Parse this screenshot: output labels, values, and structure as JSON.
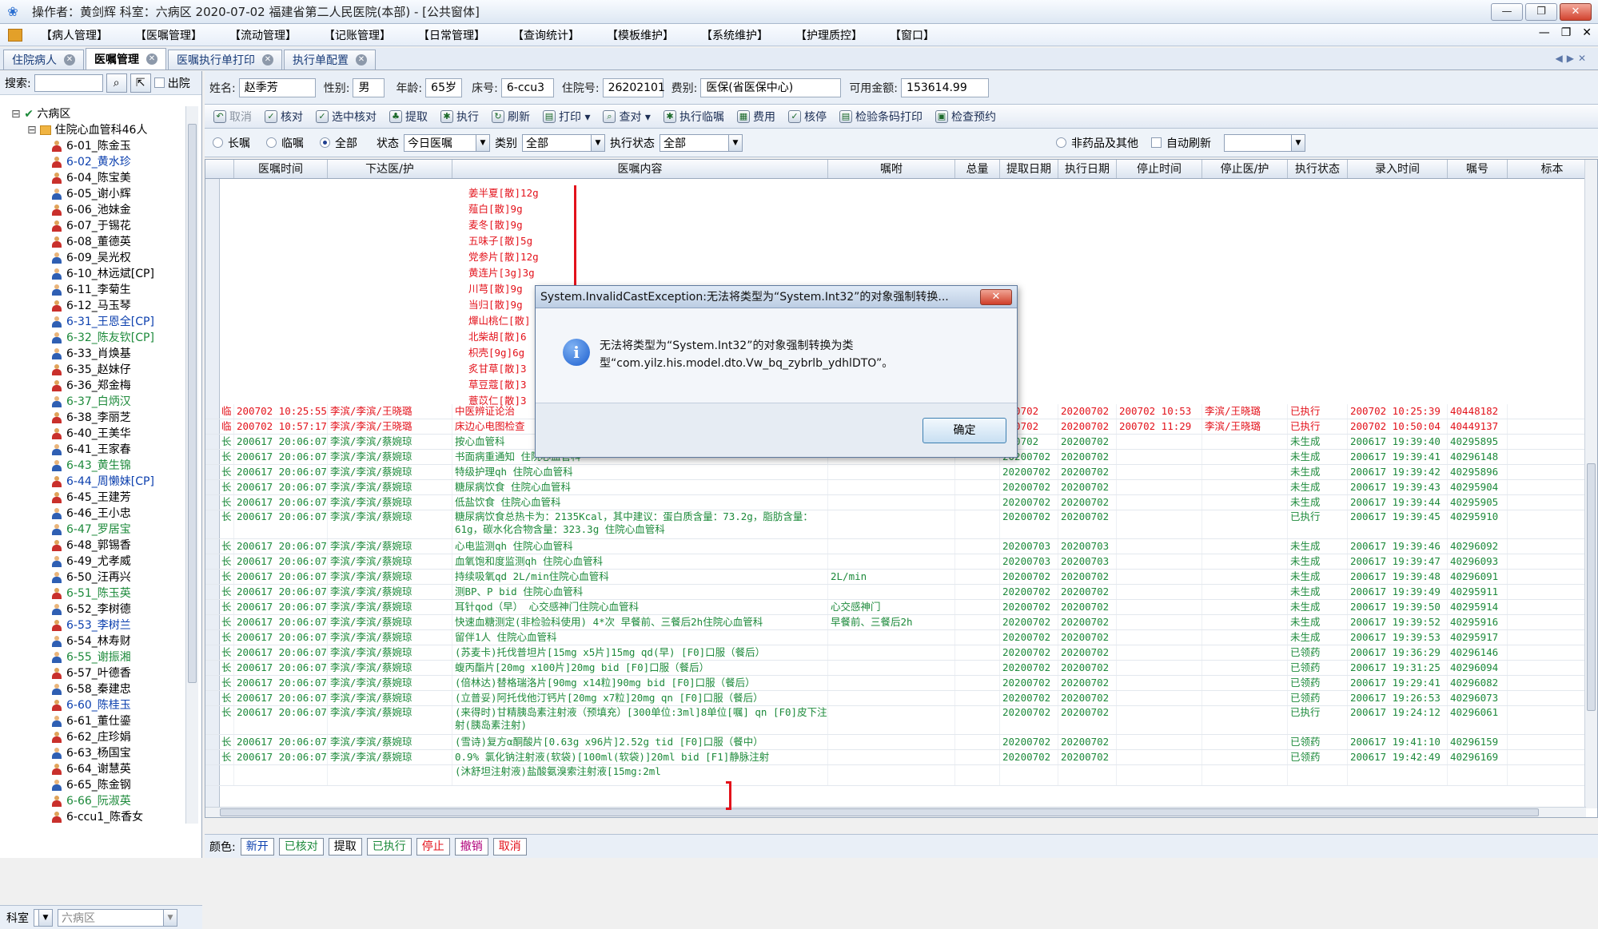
{
  "window": {
    "title": "操作者：黄剑辉  科室：六病区  2020-07-02  福建省第二人民医院(本部) - [公共窗体]",
    "buttons": [
      "—",
      "❐",
      "✕"
    ]
  },
  "menu": [
    "【病人管理】",
    "【医嘱管理】",
    "【流动管理】",
    "【记账管理】",
    "【日常管理】",
    "【查询统计】",
    "【模板维护】",
    "【系统维护】",
    "【护理质控】",
    "【窗口】"
  ],
  "mdi_buttons": [
    "—",
    "❐",
    "✕"
  ],
  "tabs": [
    {
      "label": "住院病人"
    },
    {
      "label": "医嘱管理"
    },
    {
      "label": "医嘱执行单打印"
    },
    {
      "label": "执行单配置"
    }
  ],
  "left": {
    "search_label": "搜索:",
    "discharge_label": "出院",
    "root": "六病区",
    "dept": "住院心血管科46人",
    "patients": [
      {
        "t": "6-01_陈金玉",
        "c": "#000",
        "m": false
      },
      {
        "t": "6-02_黄水珍",
        "c": "#0b3fae",
        "m": false
      },
      {
        "t": "6-04_陈宝美",
        "c": "#000",
        "m": false
      },
      {
        "t": "6-05_谢小辉",
        "c": "#000",
        "m": true
      },
      {
        "t": "6-06_池妹金",
        "c": "#000",
        "m": false
      },
      {
        "t": "6-07_于锡花",
        "c": "#000",
        "m": false
      },
      {
        "t": "6-08_董德英",
        "c": "#000",
        "m": false
      },
      {
        "t": "6-09_吴光权",
        "c": "#000",
        "m": true
      },
      {
        "t": "6-10_林远斌[CP]",
        "c": "#000",
        "m": true
      },
      {
        "t": "6-11_李菊生",
        "c": "#000",
        "m": true
      },
      {
        "t": "6-12_马玉琴",
        "c": "#000",
        "m": false
      },
      {
        "t": "6-31_王恩全[CP]",
        "c": "#0b3fae",
        "m": true
      },
      {
        "t": "6-32_陈友钦[CP]",
        "c": "#1d8a3b",
        "m": true
      },
      {
        "t": "6-33_肖焕基",
        "c": "#000",
        "m": true
      },
      {
        "t": "6-35_赵妹仔",
        "c": "#000",
        "m": false
      },
      {
        "t": "6-36_郑金梅",
        "c": "#000",
        "m": false
      },
      {
        "t": "6-37_白炳汉",
        "c": "#1d8a3b",
        "m": true
      },
      {
        "t": "6-38_李丽芝",
        "c": "#000",
        "m": false
      },
      {
        "t": "6-40_王美华",
        "c": "#000",
        "m": false
      },
      {
        "t": "6-41_王家春",
        "c": "#000",
        "m": true
      },
      {
        "t": "6-43_黄生锦",
        "c": "#1d8a3b",
        "m": true
      },
      {
        "t": "6-44_周懒妹[CP]",
        "c": "#0b3fae",
        "m": false
      },
      {
        "t": "6-45_王建芳",
        "c": "#000",
        "m": false
      },
      {
        "t": "6-46_王小忠",
        "c": "#000",
        "m": true
      },
      {
        "t": "6-47_罗居宝",
        "c": "#1d8a3b",
        "m": true
      },
      {
        "t": "6-48_郭锡香",
        "c": "#000",
        "m": false
      },
      {
        "t": "6-49_尤孝威",
        "c": "#000",
        "m": true
      },
      {
        "t": "6-50_汪再兴",
        "c": "#000",
        "m": true
      },
      {
        "t": "6-51_陈玉英",
        "c": "#1d8a3b",
        "m": false
      },
      {
        "t": "6-52_李树德",
        "c": "#000",
        "m": true
      },
      {
        "t": "6-53_李树兰",
        "c": "#0b3fae",
        "m": false
      },
      {
        "t": "6-54_林寿财",
        "c": "#000",
        "m": true
      },
      {
        "t": "6-55_谢振湘",
        "c": "#1d8a3b",
        "m": true
      },
      {
        "t": "6-57_叶德香",
        "c": "#000",
        "m": false
      },
      {
        "t": "6-58_秦建忠",
        "c": "#000",
        "m": true
      },
      {
        "t": "6-60_陈桂玉",
        "c": "#0b3fae",
        "m": false
      },
      {
        "t": "6-61_董仕鎏",
        "c": "#000",
        "m": true
      },
      {
        "t": "6-62_庄珍娟",
        "c": "#000",
        "m": false
      },
      {
        "t": "6-63_杨国宝",
        "c": "#000",
        "m": true
      },
      {
        "t": "6-64_谢慧英",
        "c": "#000",
        "m": false
      },
      {
        "t": "6-65_陈金钢",
        "c": "#000",
        "m": true
      },
      {
        "t": "6-66_阮淑英",
        "c": "#1d8a3b",
        "m": false
      },
      {
        "t": "6-ccu1_陈香女",
        "c": "#000",
        "m": false
      }
    ],
    "bottom_dept_label": "科室",
    "bottom_dept_value": "六病区"
  },
  "patient": {
    "name_label": "姓名:",
    "name": "赵季芳",
    "sex_label": "性别:",
    "sex": "男",
    "age_label": "年龄:",
    "age": "65岁",
    "bed_label": "床号:",
    "bed": "6-ccu3",
    "admission_label": "住院号:",
    "admission_no": "26202101",
    "fee_type_label": "费别:",
    "fee_type": "医保(省医保中心)",
    "balance_label": "可用金额:",
    "balance": "153614.99"
  },
  "toolbar": [
    {
      "l": "取消",
      "i": "↶",
      "d": true
    },
    {
      "l": "核对",
      "i": "✓",
      "d": false
    },
    {
      "l": "选中核对",
      "i": "✓",
      "d": false
    },
    {
      "l": "提取",
      "i": "♣",
      "d": false
    },
    {
      "l": "执行",
      "i": "✱",
      "d": false
    },
    {
      "l": "刷新",
      "i": "↻",
      "d": false
    },
    {
      "l": "打印 ▾",
      "i": "▤",
      "d": false
    },
    {
      "l": "查对 ▾",
      "i": "⌕",
      "d": false
    },
    {
      "l": "执行临嘱",
      "i": "✱",
      "d": false
    },
    {
      "l": "费用",
      "i": "▦",
      "d": false
    },
    {
      "l": "核停",
      "i": "✓",
      "d": false
    },
    {
      "l": "检验条码打印",
      "i": "▤",
      "d": false
    },
    {
      "l": "检查预约",
      "i": "▣",
      "d": false
    }
  ],
  "filters": {
    "long": "长嘱",
    "temp": "临嘱",
    "all": "全部",
    "status_label": "状态",
    "status": "今日医嘱",
    "type_label": "类别",
    "type": "全部",
    "exec_label": "执行状态",
    "exec": "全部",
    "nondrug": "非药品及其他",
    "autorefresh": "自动刷新"
  },
  "columns": [
    "医嘱时间",
    "下达医/护",
    "医嘱内容",
    "嘱咐",
    "总量",
    "提取日期",
    "执行日期",
    "停止时间",
    "停止医/护",
    "执行状态",
    "录入时间",
    "嘱号",
    "标本"
  ],
  "herbs": [
    "姜半夏[散]12g",
    "薤白[散]9g",
    "麦冬[散]9g",
    "五味子[散]5g",
    "党参片[散]12g",
    "黄连片[3g]3g",
    "川芎[散]9g",
    "当归[散]9g",
    "燀山桃仁[散]",
    "北柴胡[散]6",
    "枳壳[9g]6g",
    "炙甘草[散]3",
    "草豆蔻[散]3",
    "薏苡仁[散]3"
  ],
  "rows": [
    {
      "k": "临",
      "t": "200702 10:25:55",
      "d": "李滨/李滨/王晓璐",
      "c": "中医辨证论治",
      "z": "",
      "q": "",
      "e": "200702",
      "x": "20200702",
      "s": "200702 10:53",
      "sd": "李滨/王晓璐",
      "st": "已执行",
      "r": "200702 10:25:39",
      "n": "40448182",
      "cls": "c-red",
      "h": 19
    },
    {
      "k": "临",
      "t": "200702 10:57:17",
      "d": "李滨/李滨/王晓璐",
      "c": "床边心电图检查",
      "z": "",
      "q": "",
      "e": "200702",
      "x": "20200702",
      "s": "200702 11:29",
      "sd": "李滨/王晓璐",
      "st": "已执行",
      "r": "200702 10:50:04",
      "n": "40449137",
      "cls": "c-red",
      "h": 19
    },
    {
      "k": "长",
      "t": "200617 20:06:07",
      "d": "李滨/李滨/蔡婉琼",
      "c": "按心血管科",
      "z": "",
      "q": "",
      "e": "200702",
      "x": "20200702",
      "s": "",
      "sd": "",
      "st": "未生成",
      "r": "200617 19:39:40",
      "n": "40295895",
      "cls": "c-green",
      "h": 19
    },
    {
      "k": "长",
      "t": "200617 20:06:07",
      "d": "李滨/李滨/蔡婉琼",
      "c": "书面病重通知  住院心血管科",
      "z": "",
      "q": "",
      "e": "20200702",
      "x": "20200702",
      "s": "",
      "sd": "",
      "st": "未生成",
      "r": "200617 19:39:41",
      "n": "40296148",
      "cls": "c-green",
      "h": 19
    },
    {
      "k": "长",
      "t": "200617 20:06:07",
      "d": "李滨/李滨/蔡婉琼",
      "c": "特级护理qh  住院心血管科",
      "z": "",
      "q": "",
      "e": "20200702",
      "x": "20200702",
      "s": "",
      "sd": "",
      "st": "未生成",
      "r": "200617 19:39:42",
      "n": "40295896",
      "cls": "c-green",
      "h": 19
    },
    {
      "k": "长",
      "t": "200617 20:06:07",
      "d": "李滨/李滨/蔡婉琼",
      "c": "糖尿病饮食  住院心血管科",
      "z": "",
      "q": "",
      "e": "20200702",
      "x": "20200702",
      "s": "",
      "sd": "",
      "st": "未生成",
      "r": "200617 19:39:43",
      "n": "40295904",
      "cls": "c-green",
      "h": 19
    },
    {
      "k": "长",
      "t": "200617 20:06:07",
      "d": "李滨/李滨/蔡婉琼",
      "c": "低盐饮食  住院心血管科",
      "z": "",
      "q": "",
      "e": "20200702",
      "x": "20200702",
      "s": "",
      "sd": "",
      "st": "未生成",
      "r": "200617 19:39:44",
      "n": "40295905",
      "cls": "c-green",
      "h": 19
    },
    {
      "k": "长",
      "t": "200617 20:06:07",
      "d": "李滨/李滨/蔡婉琼",
      "c": "糖尿病饮食总热卡为：2135Kcal，其中建议：蛋白质含量：73.2g，脂肪含量：61g，碳水化合物含量：323.3g  住院心血管科",
      "z": "",
      "q": "",
      "e": "20200702",
      "x": "20200702",
      "s": "",
      "sd": "",
      "st": "已执行",
      "r": "200617 19:39:45",
      "n": "40295910",
      "cls": "c-green",
      "h": 36
    },
    {
      "k": "长",
      "t": "200617 20:06:07",
      "d": "李滨/李滨/蔡婉琼",
      "c": "心电监测qh  住院心血管科",
      "z": "",
      "q": "",
      "e": "20200703",
      "x": "20200703",
      "s": "",
      "sd": "",
      "st": "未生成",
      "r": "200617 19:39:46",
      "n": "40296092",
      "cls": "c-green",
      "h": 19
    },
    {
      "k": "长",
      "t": "200617 20:06:07",
      "d": "李滨/李滨/蔡婉琼",
      "c": "血氧饱和度监测qh  住院心血管科",
      "z": "",
      "q": "",
      "e": "20200703",
      "x": "20200703",
      "s": "",
      "sd": "",
      "st": "未生成",
      "r": "200617 19:39:47",
      "n": "40296093",
      "cls": "c-green",
      "h": 19
    },
    {
      "k": "长",
      "t": "200617 20:06:07",
      "d": "李滨/李滨/蔡婉琼",
      "c": "持续吸氧qd  2L/min住院心血管科",
      "z": "2L/min",
      "q": "",
      "e": "20200702",
      "x": "20200702",
      "s": "",
      "sd": "",
      "st": "未生成",
      "r": "200617 19:39:48",
      "n": "40296091",
      "cls": "c-green",
      "h": 19
    },
    {
      "k": "长",
      "t": "200617 20:06:07",
      "d": "李滨/李滨/蔡婉琼",
      "c": "测BP、P bid  住院心血管科",
      "z": "",
      "q": "",
      "e": "20200702",
      "x": "20200702",
      "s": "",
      "sd": "",
      "st": "未生成",
      "r": "200617 19:39:49",
      "n": "40295911",
      "cls": "c-green",
      "h": 19
    },
    {
      "k": "长",
      "t": "200617 20:06:07",
      "d": "李滨/李滨/蔡婉琼",
      "c": "耳针qod（早）  心交感神门住院心血管科",
      "z": "心交感神门",
      "q": "",
      "e": "20200702",
      "x": "20200702",
      "s": "",
      "sd": "",
      "st": "未生成",
      "r": "200617 19:39:50",
      "n": "40295914",
      "cls": "c-green",
      "h": 19
    },
    {
      "k": "长",
      "t": "200617 20:06:07",
      "d": "李滨/李滨/蔡婉琼",
      "c": "快速血糖测定(非检验科使用) 4*次 早餐前、三餐后2h住院心血管科",
      "z": "早餐前、三餐后2h",
      "q": "",
      "e": "20200702",
      "x": "20200702",
      "s": "",
      "sd": "",
      "st": "未生成",
      "r": "200617 19:39:52",
      "n": "40295916",
      "cls": "c-green",
      "h": 19
    },
    {
      "k": "长",
      "t": "200617 20:06:07",
      "d": "李滨/李滨/蔡婉琼",
      "c": "留伴1人  住院心血管科",
      "z": "",
      "q": "",
      "e": "20200702",
      "x": "20200702",
      "s": "",
      "sd": "",
      "st": "未生成",
      "r": "200617 19:39:53",
      "n": "40295917",
      "cls": "c-green",
      "h": 19
    },
    {
      "k": "长",
      "t": "200617 20:06:07",
      "d": "李滨/李滨/蔡婉琼",
      "c": "(苏麦卡)托伐普坦片[15mg x5片]15mg qd(早) [F0]口服（餐后）",
      "z": "",
      "q": "",
      "e": "20200702",
      "x": "20200702",
      "s": "",
      "sd": "",
      "st": "已领药",
      "r": "200617 19:36:29",
      "n": "40296146",
      "cls": "c-green",
      "h": 19
    },
    {
      "k": "长",
      "t": "200617 20:06:07",
      "d": "李滨/李滨/蔡婉琼",
      "c": "蝮丙酯片[20mg x100片]20mg bid [F0]口服（餐后）",
      "z": "",
      "q": "",
      "e": "20200702",
      "x": "20200702",
      "s": "",
      "sd": "",
      "st": "已领药",
      "r": "200617 19:31:25",
      "n": "40296094",
      "cls": "c-green",
      "h": 19
    },
    {
      "k": "长",
      "t": "200617 20:06:07",
      "d": "李滨/李滨/蔡婉琼",
      "c": "(倍林达)替格瑞洛片[90mg x14粒]90mg bid [F0]口服（餐后）",
      "z": "",
      "q": "",
      "e": "20200702",
      "x": "20200702",
      "s": "",
      "sd": "",
      "st": "已领药",
      "r": "200617 19:29:41",
      "n": "40296082",
      "cls": "c-green",
      "h": 19
    },
    {
      "k": "长",
      "t": "200617 20:06:07",
      "d": "李滨/李滨/蔡婉琼",
      "c": "(立普妥)阿托伐他汀钙片[20mg x7粒]20mg qn [F0]口服（餐后）",
      "z": "",
      "q": "",
      "e": "20200702",
      "x": "20200702",
      "s": "",
      "sd": "",
      "st": "已领药",
      "r": "200617 19:26:53",
      "n": "40296073",
      "cls": "c-green",
      "h": 19
    },
    {
      "k": "长",
      "t": "200617 20:06:07",
      "d": "李滨/李滨/蔡婉琼",
      "c": "(来得时)甘精胰岛素注射液（预填充）[300单位:3ml]8单位[嘱] qn [F0]皮下注射(胰岛素注射)",
      "z": "",
      "q": "",
      "e": "20200702",
      "x": "20200702",
      "s": "",
      "sd": "",
      "st": "已执行",
      "r": "200617 19:24:12",
      "n": "40296061",
      "cls": "c-green",
      "h": 36
    },
    {
      "k": "长",
      "t": "200617 20:06:07",
      "d": "李滨/李滨/蔡婉琼",
      "c": "(雪诗)复方α酮酸片[0.63g x96片]2.52g tid [F0]口服（餐中）",
      "z": "",
      "q": "",
      "e": "20200702",
      "x": "20200702",
      "s": "",
      "sd": "",
      "st": "已领药",
      "r": "200617 19:41:10",
      "n": "40296159",
      "cls": "c-green",
      "h": 19
    },
    {
      "k": "长",
      "t": "200617 20:06:07",
      "d": "李滨/李滨/蔡婉琼",
      "c": "0.9% 氯化钠注射液(软袋)[100ml(软袋)]20ml      bid [F1]静脉注射",
      "z": "",
      "q": "",
      "e": "20200702",
      "x": "20200702",
      "s": "",
      "sd": "",
      "st": "已领药",
      "r": "200617 19:42:49",
      "n": "40296169",
      "cls": "c-green",
      "h": 19
    },
    {
      "k": "",
      "t": "",
      "d": "",
      "c": "(沐舒坦注射液)盐酸氨溴索注射液[15mg:2ml",
      "z": "",
      "q": "",
      "e": "",
      "x": "",
      "s": "",
      "sd": "",
      "st": "",
      "r": "",
      "n": "",
      "cls": "c-green",
      "h": 26
    }
  ],
  "legend": {
    "label": "颜色:",
    "items": [
      {
        "l": "新开",
        "c": "#0b3fae"
      },
      {
        "l": "已核对",
        "c": "#1d8a3b"
      },
      {
        "l": "提取",
        "c": "#000"
      },
      {
        "l": "已执行",
        "c": "#1d8a3b"
      },
      {
        "l": "停止",
        "c": "#e3121b"
      },
      {
        "l": "撤销",
        "c": "#b0007a"
      },
      {
        "l": "取消",
        "c": "#e3121b"
      }
    ]
  },
  "dialog": {
    "title": "System.InvalidCastException:无法将类型为“System.Int32”的对象强制转换...",
    "message": "无法将类型为“System.Int32”的对象强制转换为类型“com.yilz.his.model.dto.Vw_bq_zybrlb_ydhlDTO”。",
    "ok": "确定",
    "close": "✕"
  }
}
